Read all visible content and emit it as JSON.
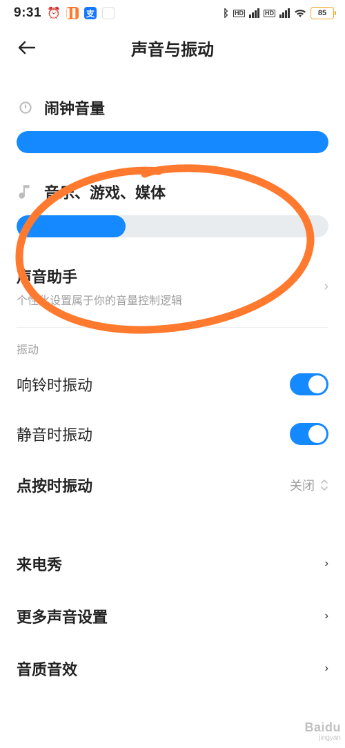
{
  "status": {
    "time": "9:31",
    "battery": "85"
  },
  "header": {
    "title": "声音与振动"
  },
  "sliders": {
    "alarm": {
      "label": "闹钟音量",
      "percent": 100
    },
    "media": {
      "label": "音乐、游戏、媒体",
      "percent": 35
    }
  },
  "assistant": {
    "title": "声音助手",
    "subtitle": "个性化设置属于你的音量控制逻辑"
  },
  "section_vibration_label": "振动",
  "toggles": {
    "ring": {
      "label": "响铃时振动",
      "on": true
    },
    "silent": {
      "label": "静音时振动",
      "on": true
    }
  },
  "tap_vibrate": {
    "label": "点按时振动",
    "value": "关闭"
  },
  "links": {
    "call_show": "来电秀",
    "more_sound": "更多声音设置",
    "sound_quality": "音质音效"
  },
  "watermark": {
    "brand": "Baidu",
    "sub": "jingyan"
  }
}
